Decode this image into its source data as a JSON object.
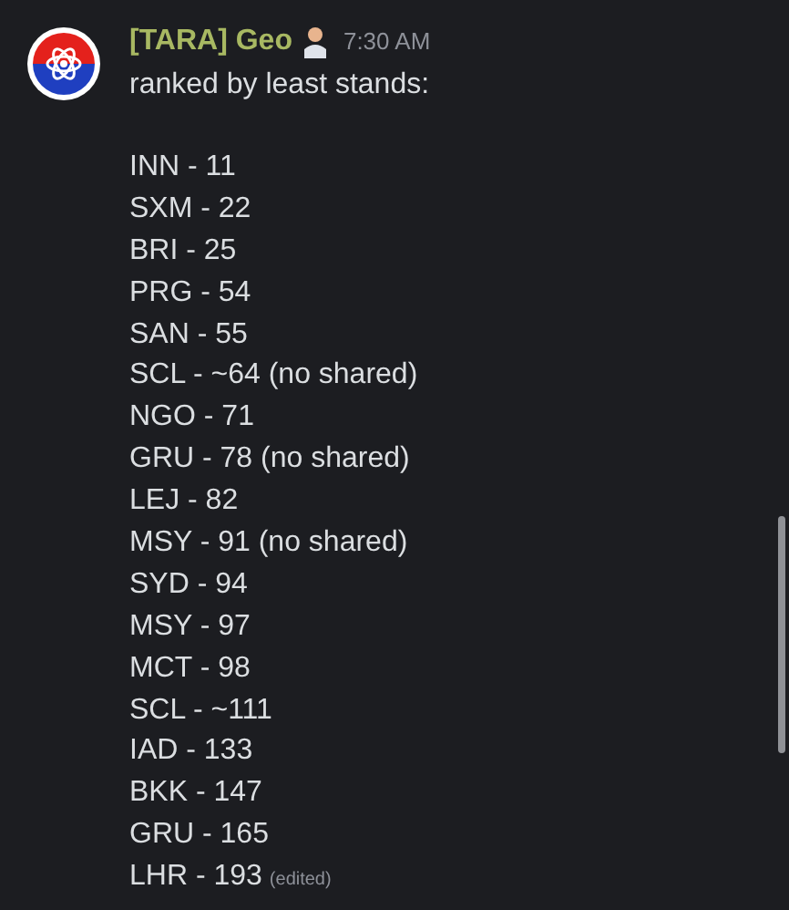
{
  "message": {
    "author": "[TARA] Geo",
    "timestamp": "7:30 AM",
    "intro": "ranked by least stands:",
    "lines": [
      "INN - 11",
      "SXM - 22",
      "BRI - 25",
      "PRG - 54",
      "SAN - 55",
      "SCL - ~64 (no shared)",
      "NGO - 71",
      "GRU - 78 (no shared)",
      "LEJ - 82",
      "MSY - 91 (no shared)",
      "SYD - 94",
      "MSY - 97",
      "MCT - 98",
      "SCL - ~111",
      "IAD - 133",
      "BKK - 147",
      "GRU - 165",
      "LHR - 193"
    ],
    "edited_label": "(edited)"
  }
}
